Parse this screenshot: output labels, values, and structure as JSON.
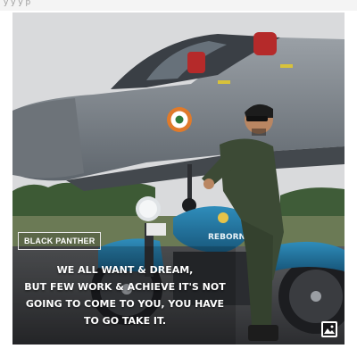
{
  "header": {
    "partial_text": "y y y p"
  },
  "post": {
    "badge": "BLACK PANTHER",
    "quote_lines": [
      "WE ALL WANT & DREAM,",
      "BUT FEW WORK & ACHIEVE IT'S NOT",
      "GOING TO COME TO YOU, YOU HAVE",
      "TO GO TAKE IT."
    ],
    "bike_text": "REBORN",
    "colors": {
      "sky": "#d9dadc",
      "jet": "#7f868e",
      "bike": "#1f6f96",
      "flight_suit": "#3c4a35",
      "roundel_outer": "#e07a2a"
    }
  },
  "icons": {
    "expand": "expand-image-icon"
  }
}
